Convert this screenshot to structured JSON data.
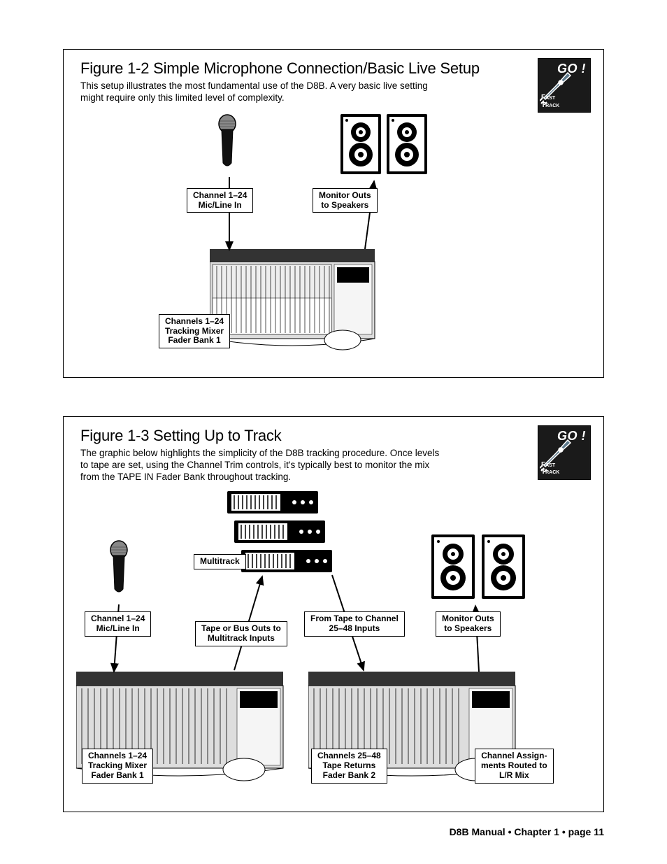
{
  "fig1": {
    "title": "Figure 1-2 Simple Microphone Connection/Basic Live Setup",
    "desc": "This setup illustrates the most fundamental use of the D8B. A very basic live setting might require only this limited level of complexity.",
    "badge": {
      "go": "GO !",
      "fast": "Fast",
      "track": "Track"
    },
    "labels": {
      "micIn": "Channel 1–24\nMic/Line In",
      "monOut": "Monitor Outs\nto Speakers",
      "faderBank": "Channels 1–24\nTracking Mixer\nFader Bank 1"
    }
  },
  "fig2": {
    "title": "Figure 1-3 Setting Up to Track",
    "desc": "The graphic below highlights the simplicity of the D8B tracking procedure. Once levels to tape are set, using the Channel Trim controls, it's typically best to monitor the mix from the TAPE IN Fader Bank throughout tracking.",
    "badge": {
      "go": "GO !",
      "fast": "Fast",
      "track": "Track"
    },
    "labels": {
      "multitrack": "Multitrack",
      "micIn": "Channel 1–24\nMic/Line In",
      "tapeOuts": "Tape or Bus Outs to\nMultitrack Inputs",
      "fromTape": "From Tape to Channel\n25–48 Inputs",
      "monOut": "Monitor Outs\nto Speakers",
      "faderBank1": "Channels 1–24\nTracking Mixer\nFader Bank 1",
      "faderBank2": "Channels 25–48\nTape Returns\nFader Bank 2",
      "lrMix": "Channel Assign-\nments Routed to\nL/R Mix"
    }
  },
  "footer": "D8B Manual • Chapter 1 • page  11"
}
